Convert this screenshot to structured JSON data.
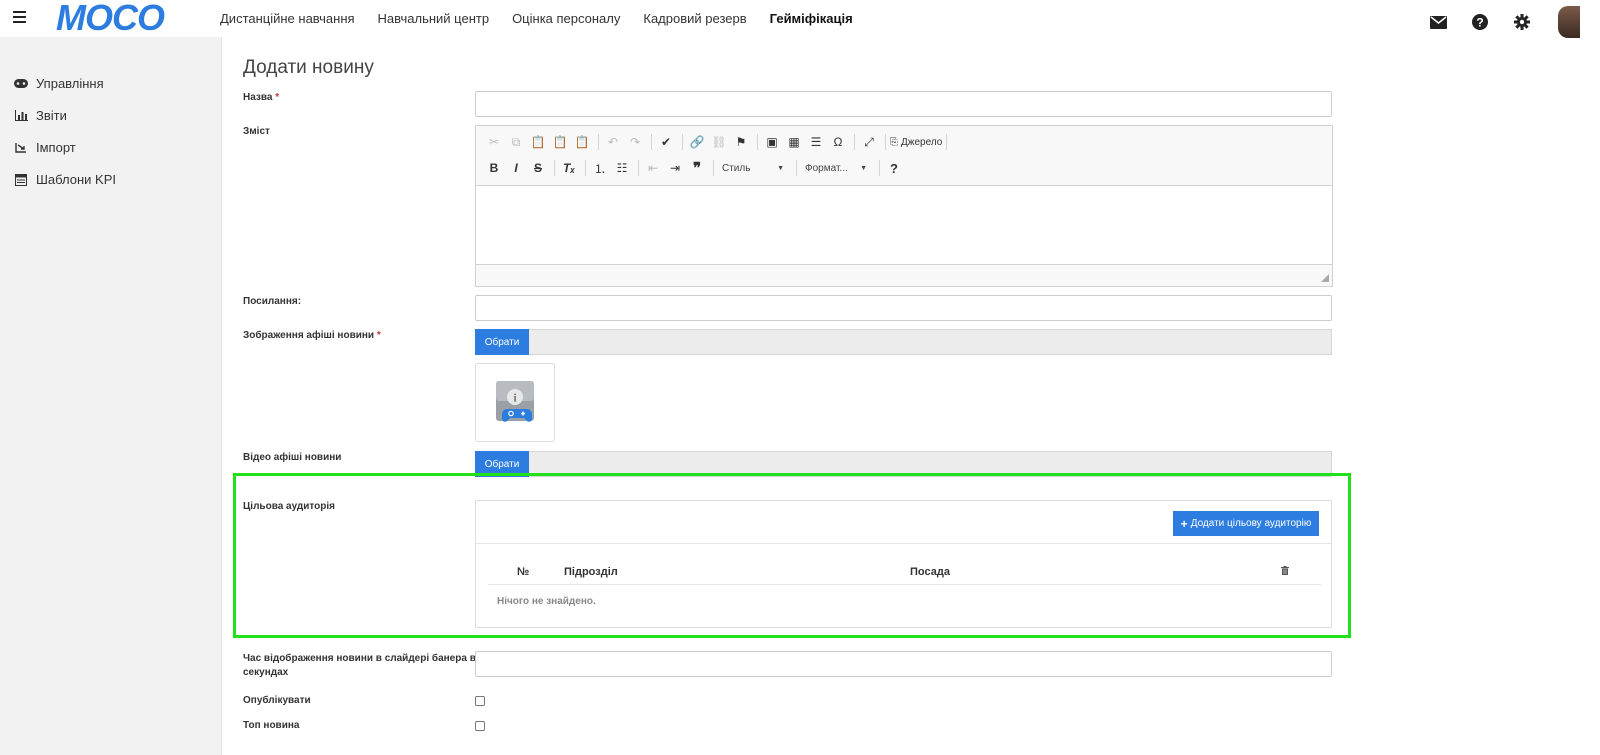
{
  "brand": {
    "logo_text": "MOCO",
    "color": "#2d7de0"
  },
  "nav": {
    "items": [
      {
        "label": "Дистанційне навчання"
      },
      {
        "label": "Навчальний центр"
      },
      {
        "label": "Оцінка персоналу"
      },
      {
        "label": "Кадровий резерв"
      },
      {
        "label": "Гейміфікація"
      }
    ],
    "active": "Гейміфікація"
  },
  "top_icons": [
    "envelope-icon",
    "help-icon",
    "gear-icon",
    "avatar"
  ],
  "sidebar": {
    "items": [
      {
        "label": "Управління",
        "icon": "gamepad-icon"
      },
      {
        "label": "Звіти",
        "icon": "chart-icon"
      },
      {
        "label": "Імпорт",
        "icon": "import-icon"
      },
      {
        "label": "Шаблони KPI",
        "icon": "template-icon"
      }
    ]
  },
  "form": {
    "title": "Додати новину",
    "name_label": "Назва",
    "content_label": "Зміст",
    "link_label": "Посилання:",
    "image_label": "Зображення афіші новини",
    "video_label": "Відео афіші новини",
    "audience_label": "Цільова аудиторія",
    "slider_time_label_1": "Час відображення новини в слайдері банера в",
    "slider_time_label_2": "секундах",
    "publish_label": "Опублікувати",
    "top_news_label": "Топ новина",
    "required_mark": "*",
    "choose_button": "Обрати",
    "name_value": "",
    "link_value": "",
    "slider_time_value": ""
  },
  "editor": {
    "source_label": "Джерело",
    "style_combo": "Стиль",
    "format_combo": "Формат..."
  },
  "audience": {
    "add_button": "Додати цільову аудиторію",
    "columns": [
      "№",
      "Підрозділ",
      "Посада"
    ],
    "empty_text": "Нічого не знайдено."
  },
  "highlight_color": "#22e01a"
}
